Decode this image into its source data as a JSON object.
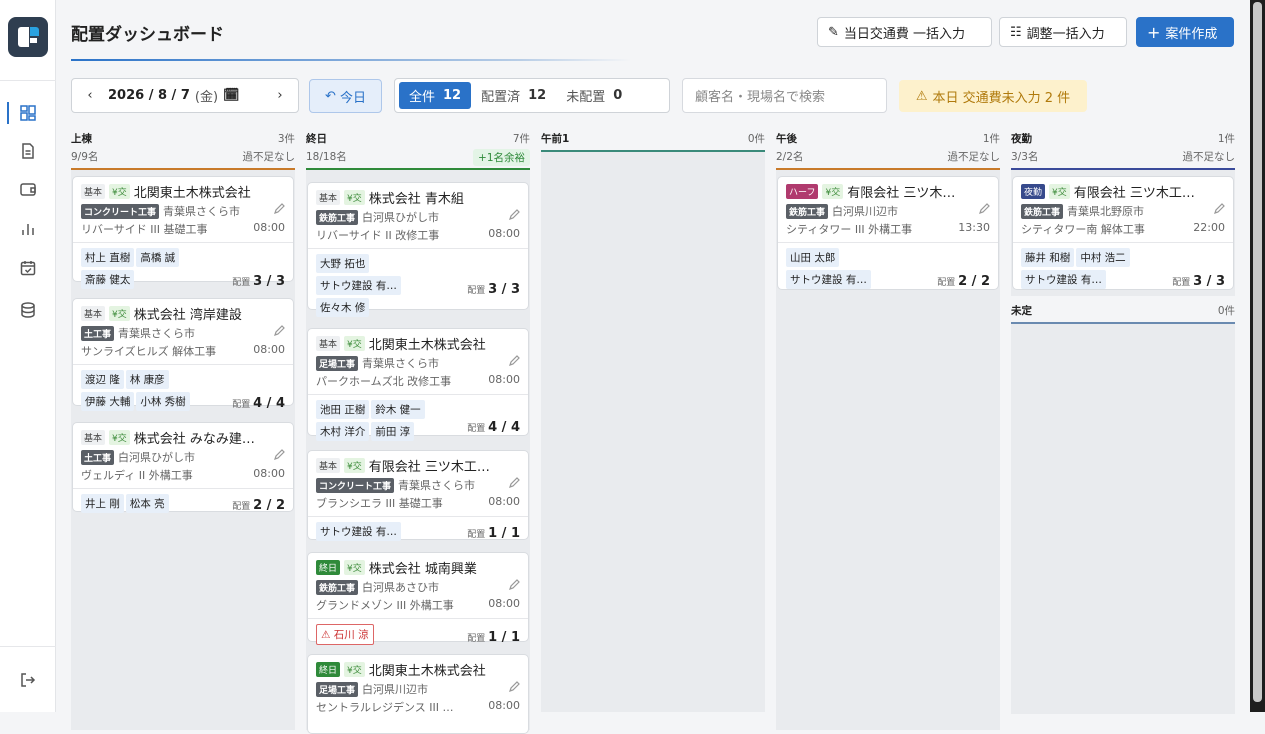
{
  "header": {
    "title": "配置ダッシュボード",
    "btn_transport": "当日交通費 一括入力",
    "btn_adjust": "調整一括入力",
    "btn_create": "案件作成"
  },
  "toolbar": {
    "prev": "‹",
    "date": "2026 / 8 / 7",
    "dow": "(金)",
    "next": "›",
    "today": "今日",
    "filter_all": "全件",
    "filter_all_count": "12",
    "filter_assigned": "配置済",
    "filter_assigned_count": "12",
    "filter_unassigned": "未配置",
    "filter_unassigned_count": "0",
    "search_placeholder": "顧客名・現場名で検索",
    "warning": "本日 交通費未入力 2 件"
  },
  "columns": [
    {
      "name": "上棟",
      "count": "3件",
      "staff": "9/9名",
      "status": "過不足なし",
      "color": "#c87a2a"
    },
    {
      "name": "終日",
      "count": "7件",
      "staff": "18/18名",
      "status": "+1名余裕",
      "color": "#2f8a3a"
    },
    {
      "name": "午前1",
      "count": "0件",
      "staff": "",
      "status": "",
      "color": "#3a8a7a"
    },
    {
      "name": "午後",
      "count": "1件",
      "staff": "2/2名",
      "status": "過不足なし",
      "color": "#c87a2a"
    },
    {
      "name": "夜勤",
      "count": "1件",
      "staff": "3/3名",
      "status": "過不足なし",
      "color": "#3a4a9a"
    },
    {
      "name": "未定",
      "count": "0件",
      "staff": "",
      "status": "",
      "color": "#6a8ab0"
    }
  ],
  "cards": [
    {
      "shift": "基本",
      "yen": "¥交",
      "client": "北関東土木株式会社",
      "work": "コンクリート工事",
      "area": "青葉県さくら市",
      "site": "リバーサイド III 基礎工事",
      "time": "08:00",
      "workers": [
        "村上 直樹",
        "高橋 誠",
        "斎藤 健太"
      ],
      "haichi": "配置",
      "ratio": "3 / 3"
    },
    {
      "shift": "基本",
      "yen": "¥交",
      "client": "株式会社 湾岸建設",
      "work": "土工事",
      "area": "青葉県さくら市",
      "site": "サンライズヒルズ 解体工事",
      "time": "08:00",
      "workers": [
        "渡辺 隆",
        "林 康彦",
        "伊藤 大輔",
        "小林 秀樹"
      ],
      "haichi": "配置",
      "ratio": "4 / 4"
    },
    {
      "shift": "基本",
      "yen": "¥交",
      "client": "株式会社 みなみ建…",
      "work": "土工事",
      "area": "白河県ひがし市",
      "site": "ヴェルディ II 外構工事",
      "time": "08:00",
      "workers": [
        "井上 剛",
        "松本 亮"
      ],
      "haichi": "配置",
      "ratio": "2 / 2"
    },
    {
      "shift": "基本",
      "yen": "¥交",
      "client": "株式会社 青木組",
      "work": "鉄筋工事",
      "area": "白河県ひがし市",
      "site": "リバーサイド II 改修工事",
      "time": "08:00",
      "workers": [
        "大野 拓也",
        "サトウ建設 有…",
        "佐々木 修"
      ],
      "haichi": "配置",
      "ratio": "3 / 3"
    },
    {
      "shift": "基本",
      "yen": "¥交",
      "client": "北関東土木株式会社",
      "work": "足場工事",
      "area": "青葉県さくら市",
      "site": "パークホームズ北 改修工事",
      "time": "08:00",
      "workers": [
        "池田 正樹",
        "鈴木 健一",
        "木村 洋介",
        "前田 淳"
      ],
      "haichi": "配置",
      "ratio": "4 / 4"
    },
    {
      "shift": "基本",
      "yen": "¥交",
      "client": "有限会社 三ツ木工…",
      "work": "コンクリート工事",
      "area": "青葉県さくら市",
      "site": "ブランシエラ III 基礎工事",
      "time": "08:00",
      "workers": [
        "サトウ建設 有…"
      ],
      "haichi": "配置",
      "ratio": "1 / 1"
    },
    {
      "shift": "終日",
      "yen": "¥交",
      "client": "株式会社 城南興業",
      "work": "鉄筋工事",
      "area": "白河県あさひ市",
      "site": "グランドメゾン III 外構工事",
      "time": "08:00",
      "workers": [
        "⚠ 石川 涼"
      ],
      "haichi": "配置",
      "ratio": "1 / 1"
    },
    {
      "shift": "終日",
      "yen": "¥交",
      "client": "北関東土木株式会社",
      "work": "足場工事",
      "area": "白河県川辺市",
      "site": "セントラルレジデンス III …",
      "time": "08:00",
      "workers": [],
      "haichi": "",
      "ratio": ""
    },
    {
      "shift": "ハーフ",
      "yen": "¥交",
      "client": "有限会社 三ツ木…",
      "work": "鉄筋工事",
      "area": "白河県川辺市",
      "site": "シティタワー III 外構工事",
      "time": "13:30",
      "workers": [
        "山田 太郎",
        "サトウ建設 有…"
      ],
      "haichi": "配置",
      "ratio": "2 / 2"
    },
    {
      "shift": "夜勤",
      "yen": "¥交",
      "client": "有限会社 三ツ木工…",
      "work": "鉄筋工事",
      "area": "青葉県北野原市",
      "site": "シティタワー南 解体工事",
      "time": "22:00",
      "workers": [
        "藤井 和樹",
        "中村 浩二",
        "サトウ建設 有…"
      ],
      "haichi": "配置",
      "ratio": "3 / 3"
    }
  ]
}
